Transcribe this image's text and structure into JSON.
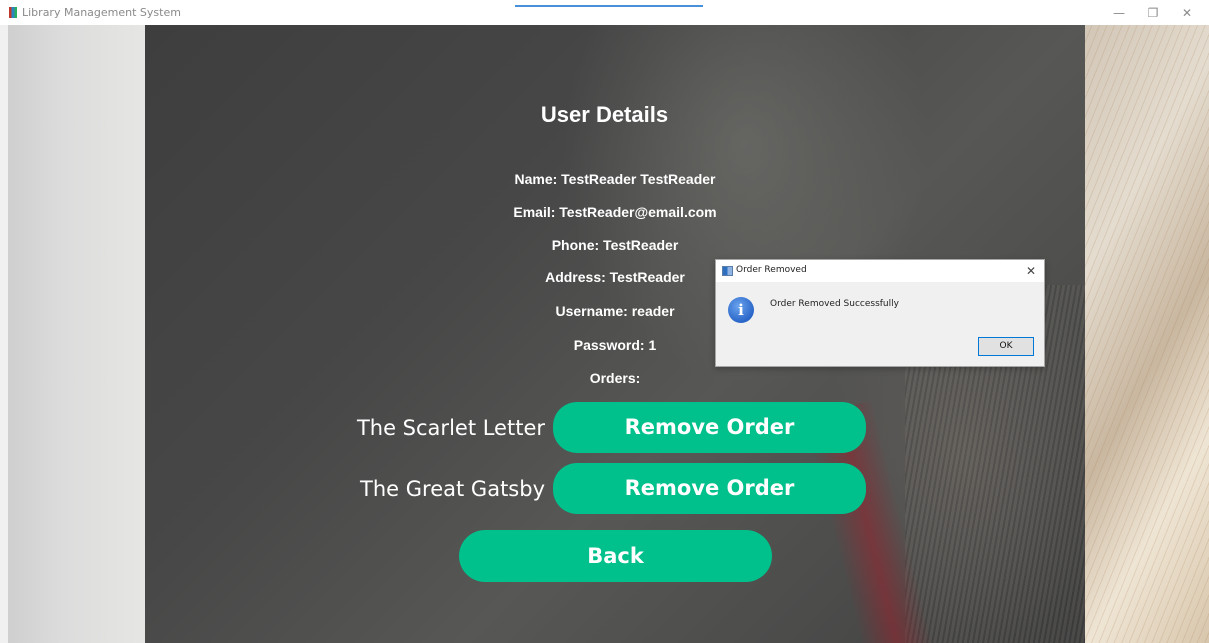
{
  "window": {
    "title": "Library Management System",
    "minimize_glyph": "—",
    "maximize_glyph": "❐",
    "close_glyph": "✕"
  },
  "user_details": {
    "heading": "User Details",
    "name": "Name: TestReader TestReader",
    "email": "Email: TestReader@email.com",
    "phone": "Phone: TestReader",
    "address": "Address: TestReader",
    "username": "Username: reader",
    "password": "Password: 1",
    "orders_label": "Orders:"
  },
  "orders": [
    {
      "title": "The Scarlet Letter",
      "action_label": "Remove Order"
    },
    {
      "title": "The Great Gatsby",
      "action_label": "Remove Order"
    }
  ],
  "back_label": "Back",
  "dialog": {
    "title": "Order Removed",
    "message": "Order Removed Successfully",
    "ok_label": "OK",
    "close_glyph": "✕",
    "icon_glyph": "i"
  },
  "colors": {
    "accent": "#00c08b",
    "info_icon": "#2a66c8"
  },
  "icons": {
    "app": "app-icon",
    "dialog_window": "window-icon",
    "dialog_info": "info-icon"
  }
}
